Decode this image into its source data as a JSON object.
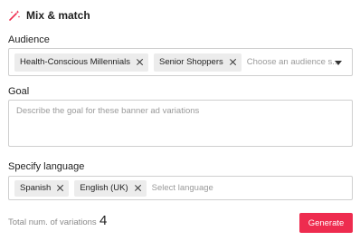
{
  "header": {
    "title": "Mix & match",
    "icon": "magic-wand-icon",
    "accent": "#ee2c4f"
  },
  "audience": {
    "label": "Audience",
    "chips": [
      "Health-Conscious Millennials",
      "Senior Shoppers"
    ],
    "placeholder": "Choose an audience s..."
  },
  "goal": {
    "label": "Goal",
    "placeholder": "Describe the goal for these banner ad variations",
    "value": ""
  },
  "language": {
    "label": "Specify language",
    "chips": [
      "Spanish",
      "English (UK)"
    ],
    "placeholder": "Select language"
  },
  "footer": {
    "total_label": "Total num. of variations",
    "total_value": "4",
    "generate_label": "Generate"
  }
}
